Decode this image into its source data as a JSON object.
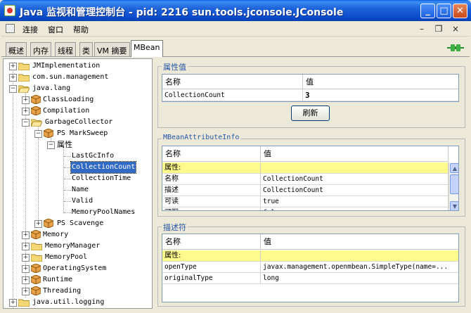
{
  "window": {
    "title": "Java 监视和管理控制台 - pid: 2216 sun.tools.jconsole.JConsole",
    "min": "_",
    "max": "□",
    "close": "✕"
  },
  "menu": {
    "connect": "连接",
    "window": "窗口",
    "help": "帮助"
  },
  "mdi": {
    "min": "–",
    "restore": "❐",
    "close": "×"
  },
  "tabs": [
    "概述",
    "内存",
    "线程",
    "类",
    "VM 摘要",
    "MBean"
  ],
  "tree": {
    "jmi": "JMImplementation",
    "csm": "com.sun.management",
    "javalang": "java.lang",
    "classloading": "ClassLoading",
    "compilation": "Compilation",
    "gc": "GarbageCollector",
    "psms": "PS MarkSweep",
    "attrs": "属性",
    "lastgc": "LastGcInfo",
    "collcount": "CollectionCount",
    "colltime": "CollectionTime",
    "name": "Name",
    "valid": "Valid",
    "mempools": "MemoryPoolNames",
    "psscav": "PS Scavenge",
    "memory": "Memory",
    "memmgr": "MemoryManager",
    "mempool": "MemoryPool",
    "os": "OperatingSystem",
    "runtime": "Runtime",
    "threading": "Threading",
    "logging": "java.util.logging"
  },
  "attr_panel": {
    "legend": "属性值",
    "col_name": "名称",
    "col_value": "值",
    "row_name": "CollectionCount",
    "row_value": "3",
    "refresh": "刷新"
  },
  "info_panel": {
    "legend": "MBeanAttributeInfo",
    "col_name": "名称",
    "col_value": "值",
    "rows": [
      {
        "name": "属性:",
        "value": ""
      },
      {
        "name": "名称",
        "value": "CollectionCount"
      },
      {
        "name": "描述",
        "value": "CollectionCount"
      },
      {
        "name": "可读",
        "value": "true"
      },
      {
        "name": "可写",
        "value": "false"
      }
    ]
  },
  "desc_panel": {
    "legend": "描述符",
    "col_name": "名称",
    "col_value": "值",
    "rows": [
      {
        "name": "属性:",
        "value": ""
      },
      {
        "name": "openType",
        "value": "javax.management.openmbean.SimpleType(name=..."
      },
      {
        "name": "originalType",
        "value": "long"
      }
    ]
  },
  "colors": {
    "selection": "#316ac5",
    "highlight_row": "#fffa8c",
    "legend": "#2553a6",
    "titlebar": "#0a5fe0"
  }
}
